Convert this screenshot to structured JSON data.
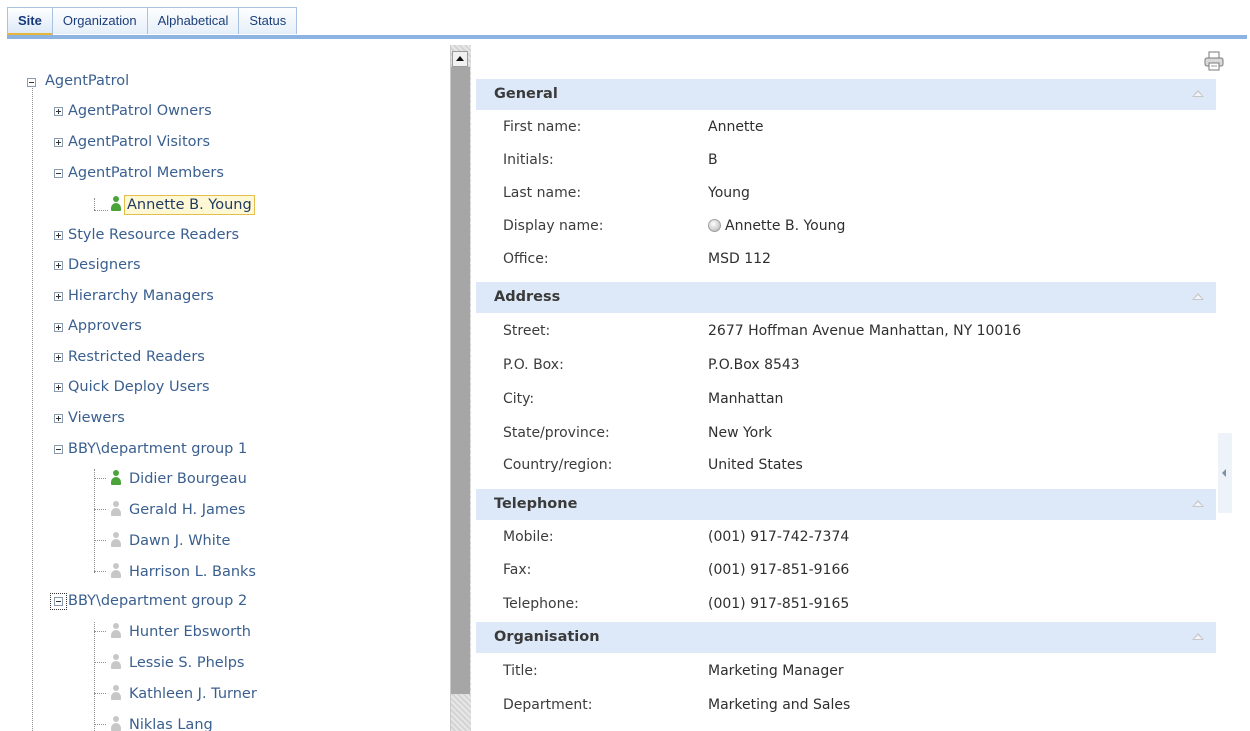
{
  "tabs": [
    {
      "label": "Site",
      "active": true
    },
    {
      "label": "Organization",
      "active": false
    },
    {
      "label": "Alphabetical",
      "active": false
    },
    {
      "label": "Status",
      "active": false
    }
  ],
  "tree": {
    "root": "AgentPatrol",
    "groups": [
      {
        "label": "AgentPatrol Owners",
        "expanded": false
      },
      {
        "label": "AgentPatrol Visitors",
        "expanded": false
      },
      {
        "label": "AgentPatrol Members",
        "expanded": true
      },
      {
        "label": "Style Resource Readers",
        "expanded": false
      },
      {
        "label": "Designers",
        "expanded": false
      },
      {
        "label": "Hierarchy Managers",
        "expanded": false
      },
      {
        "label": "Approvers",
        "expanded": false
      },
      {
        "label": "Restricted Readers",
        "expanded": false
      },
      {
        "label": "Quick Deploy Users",
        "expanded": false
      },
      {
        "label": "Viewers",
        "expanded": false
      },
      {
        "label": "BBY\\department group 1",
        "expanded": true
      },
      {
        "label": "BBY\\department group 2",
        "expanded": true
      }
    ],
    "members_group": [
      {
        "name": "Annette B. Young",
        "status": "online",
        "selected": true
      }
    ],
    "dept1": [
      {
        "name": "Didier Bourgeau",
        "status": "online"
      },
      {
        "name": "Gerald H. James",
        "status": "offline"
      },
      {
        "name": "Dawn J. White",
        "status": "offline"
      },
      {
        "name": "Harrison L. Banks",
        "status": "offline"
      }
    ],
    "dept2": [
      {
        "name": "Hunter Ebsworth",
        "status": "offline"
      },
      {
        "name": "Lessie S. Phelps",
        "status": "offline"
      },
      {
        "name": "Kathleen J. Turner",
        "status": "offline"
      },
      {
        "name": "Niklas Lang",
        "status": "offline"
      }
    ]
  },
  "details": {
    "general": {
      "title": "General",
      "first_name_label": "First name:",
      "first_name": "Annette",
      "initials_label": "Initials:",
      "initials": "B",
      "last_name_label": "Last name:",
      "last_name": "Young",
      "display_name_label": "Display name:",
      "display_name": "Annette B. Young",
      "office_label": "Office:",
      "office": "MSD 112"
    },
    "address": {
      "title": "Address",
      "street_label": "Street:",
      "street": "2677 Hoffman Avenue Manhattan, NY 10016",
      "po_box_label": "P.O. Box:",
      "po_box": "P.O.Box 8543",
      "city_label": "City:",
      "city": "Manhattan",
      "state_label": "State/province:",
      "state": "New York",
      "country_label": "Country/region:",
      "country": "United States"
    },
    "telephone": {
      "title": "Telephone",
      "mobile_label": "Mobile:",
      "mobile": "(001) 917-742-7374",
      "fax_label": "Fax:",
      "fax": "(001) 917-851-9166",
      "telephone_label": "Telephone:",
      "telephone": "(001) 917-851-9165"
    },
    "organisation": {
      "title": "Organisation",
      "title_label": "Title:",
      "job_title": "Marketing Manager",
      "department_label": "Department:",
      "department": "Marketing and Sales"
    }
  },
  "colors": {
    "section_bg": "#dde9f8",
    "tab_accent": "#e8b43a",
    "online": "#4aa43a",
    "offline": "#c7c7c7"
  }
}
